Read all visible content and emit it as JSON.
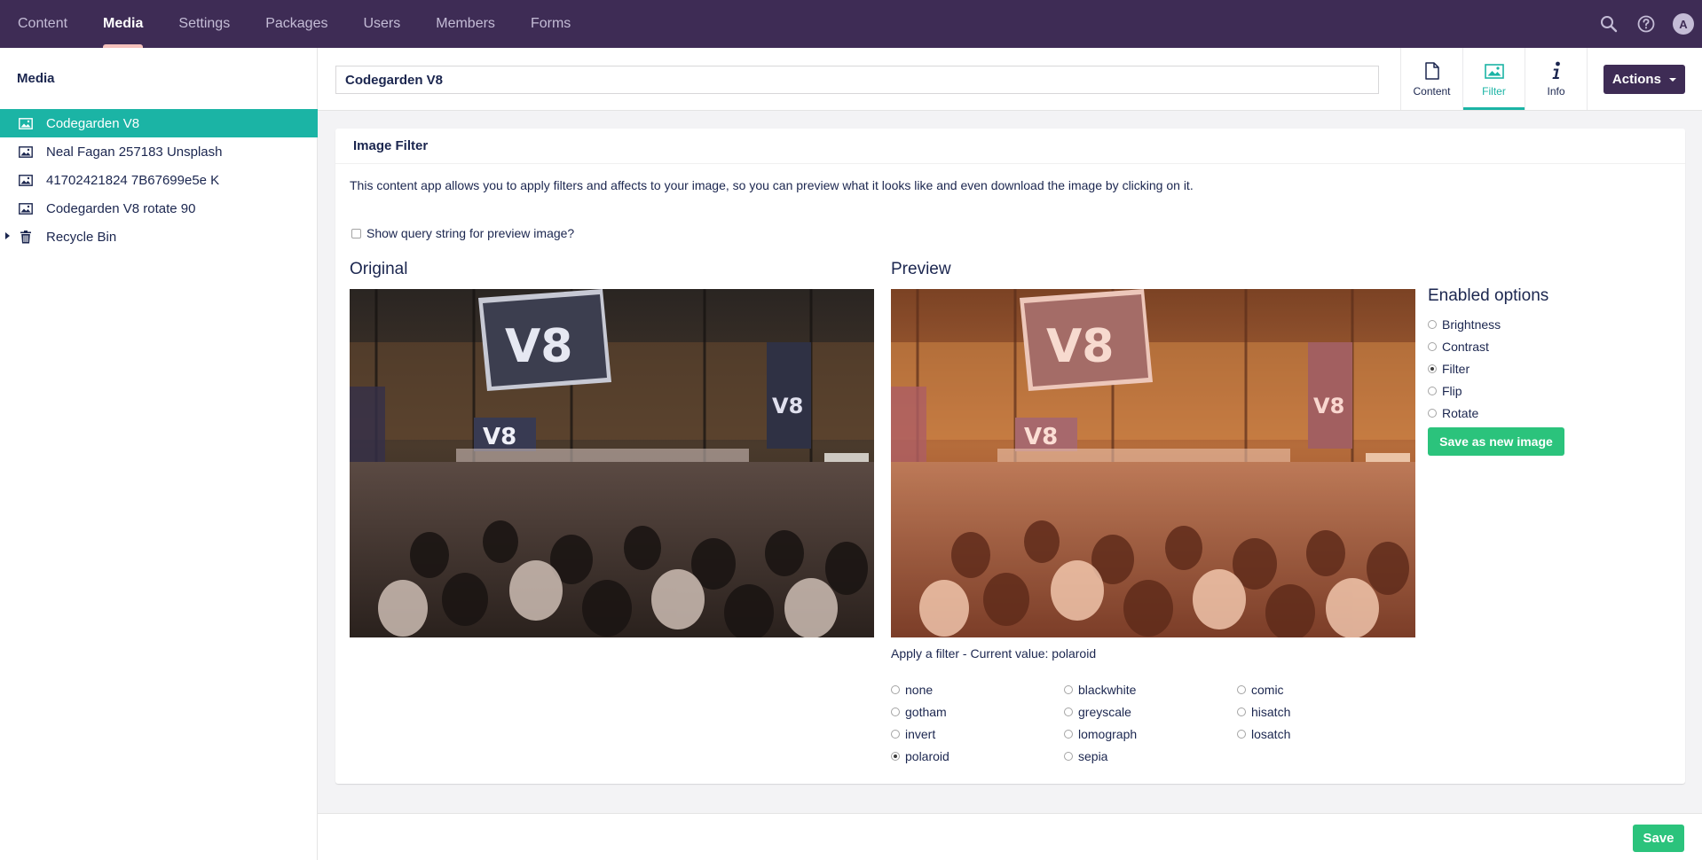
{
  "topnav": {
    "items": [
      "Content",
      "Media",
      "Settings",
      "Packages",
      "Users",
      "Members",
      "Forms"
    ],
    "active": "Media",
    "icons": [
      "search-icon",
      "help-icon"
    ],
    "avatar_initial": "A"
  },
  "tree": {
    "title": "Media",
    "items": [
      {
        "label": "Codegarden V8",
        "icon": "image-icon",
        "active": true
      },
      {
        "label": "Neal Fagan 257183 Unsplash",
        "icon": "image-icon"
      },
      {
        "label": "41702421824 7B67699e5e K",
        "icon": "image-icon"
      },
      {
        "label": "Codegarden V8 rotate 90",
        "icon": "image-icon"
      },
      {
        "label": "Recycle Bin",
        "icon": "trash-icon"
      }
    ]
  },
  "header": {
    "name_value": "Codegarden V8",
    "apps": [
      {
        "label": "Content",
        "icon": "document-icon"
      },
      {
        "label": "Filter",
        "icon": "picture-icon",
        "active": true
      },
      {
        "label": "Info",
        "icon": "info-icon"
      }
    ],
    "actions_label": "Actions"
  },
  "panel": {
    "title": "Image Filter",
    "description": "This content app allows you to apply filters and affects to your image, so you can preview what it looks like and even download the image by clicking on it.",
    "querystring_label": "Show query string for preview image?",
    "original_title": "Original",
    "preview_title": "Preview",
    "apply_label": "Apply a filter - Current value: polaroid",
    "filters": [
      "none",
      "blackwhite",
      "comic",
      "gotham",
      "greyscale",
      "hisatch",
      "invert",
      "lomograph",
      "losatch",
      "polaroid",
      "sepia"
    ],
    "selected_filter": "polaroid",
    "options_title": "Enabled options",
    "options": [
      "Brightness",
      "Contrast",
      "Filter",
      "Flip",
      "Rotate"
    ],
    "selected_option": "Filter",
    "save_new_label": "Save as new image"
  },
  "footer": {
    "save_label": "Save"
  },
  "colors": {
    "topbar": "#3e2c55",
    "accent": "#1bb4a5",
    "success": "#2bc37c",
    "text": "#1b264f"
  }
}
